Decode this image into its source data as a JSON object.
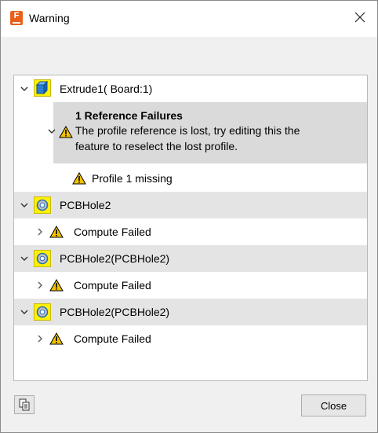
{
  "window": {
    "title": "Warning",
    "app_icon_letter": "F"
  },
  "tree": {
    "extrude": {
      "label": "Extrude1( Board:1)",
      "icon": "extrude-body-icon"
    },
    "reference_failures": {
      "title": "1 Reference Failures",
      "message": "The profile reference is lost, try editing this the feature to reselect the lost profile."
    },
    "profile_missing": {
      "label": "Profile 1 missing"
    },
    "hole1": {
      "label": "PCBHole2",
      "child": "Compute Failed"
    },
    "hole2": {
      "label": "PCBHole2(PCBHole2)",
      "child": "Compute Failed"
    },
    "hole3": {
      "label": "PCBHole2(PCBHole2)",
      "child": "Compute Failed"
    }
  },
  "footer": {
    "copy_icon": "copy-icon",
    "close_label": "Close"
  },
  "colors": {
    "warning": "#f2c200",
    "highlight": "#fff200",
    "shade": "#e4e4e4"
  }
}
